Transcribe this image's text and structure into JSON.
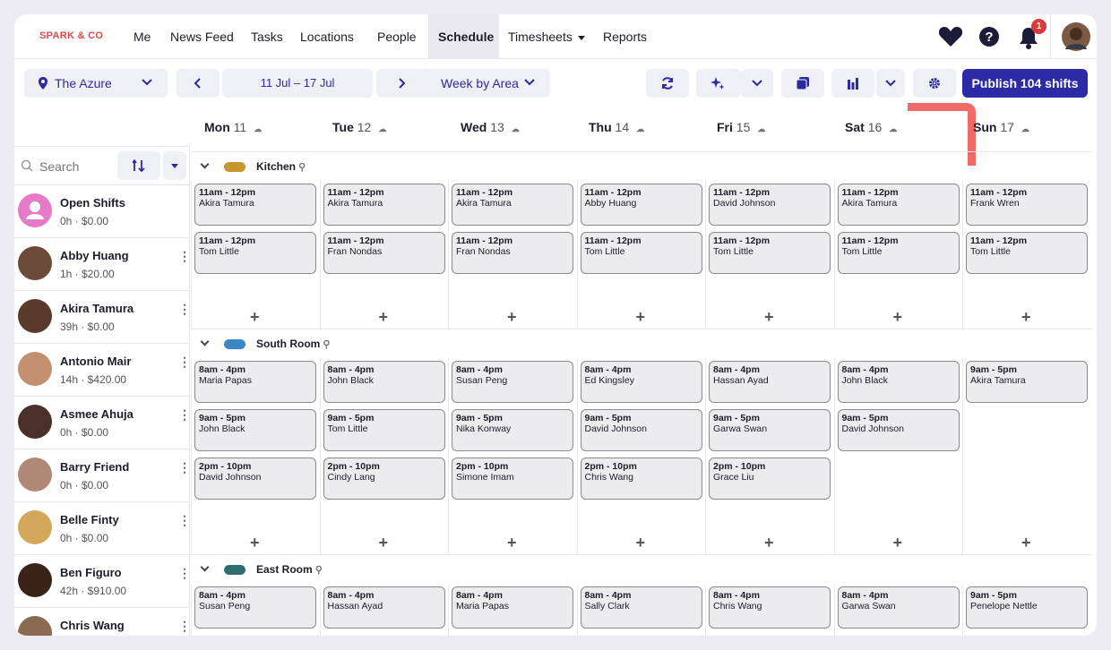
{
  "brand": "SPARK & CO",
  "nav": {
    "items": [
      "Me",
      "News Feed",
      "Tasks",
      "Locations",
      "People",
      "Schedule",
      "Timesheets",
      "Reports"
    ],
    "active": "Schedule",
    "notification_count": "1"
  },
  "toolbar": {
    "location": "The Azure",
    "date_range": "11 Jul – 17 Jul",
    "view": "Week by Area",
    "publish_label": "Publish 104 shifts"
  },
  "days": [
    {
      "name": "Mon",
      "num": "11"
    },
    {
      "name": "Tue",
      "num": "12"
    },
    {
      "name": "Wed",
      "num": "13"
    },
    {
      "name": "Thu",
      "num": "14"
    },
    {
      "name": "Fri",
      "num": "15"
    },
    {
      "name": "Sat",
      "num": "16"
    },
    {
      "name": "Sun",
      "num": "17"
    }
  ],
  "sidebar": {
    "search_placeholder": "Search",
    "people": [
      {
        "name": "Open Shifts",
        "meta": "0h · $0.00"
      },
      {
        "name": "Abby Huang",
        "meta": "1h · $20.00"
      },
      {
        "name": "Akira Tamura",
        "meta": "39h · $0.00"
      },
      {
        "name": "Antonio Mair",
        "meta": "14h · $420.00"
      },
      {
        "name": "Asmee Ahuja",
        "meta": "0h · $0.00"
      },
      {
        "name": "Barry Friend",
        "meta": "0h · $0.00"
      },
      {
        "name": "Belle Finty",
        "meta": "0h · $0.00"
      },
      {
        "name": "Ben Figuro",
        "meta": "42h · $910.00"
      },
      {
        "name": "Chris Wang",
        "meta": ""
      }
    ]
  },
  "areas": [
    {
      "name": "Kitchen",
      "color": "#c8962e",
      "shifts": [
        [
          {
            "time": "11am - 12pm",
            "who": "Akira Tamura"
          },
          {
            "time": "11am - 12pm",
            "who": "Tom Little"
          }
        ],
        [
          {
            "time": "11am - 12pm",
            "who": "Akira Tamura"
          },
          {
            "time": "11am - 12pm",
            "who": "Fran Nondas"
          }
        ],
        [
          {
            "time": "11am - 12pm",
            "who": "Akira Tamura"
          },
          {
            "time": "11am - 12pm",
            "who": "Fran Nondas"
          }
        ],
        [
          {
            "time": "11am - 12pm",
            "who": "Abby Huang"
          },
          {
            "time": "11am - 12pm",
            "who": "Tom Little"
          }
        ],
        [
          {
            "time": "11am - 12pm",
            "who": "David Johnson"
          },
          {
            "time": "11am - 12pm",
            "who": "Tom Little"
          }
        ],
        [
          {
            "time": "11am - 12pm",
            "who": "Akira Tamura"
          },
          {
            "time": "11am - 12pm",
            "who": "Tom Little"
          }
        ],
        [
          {
            "time": "11am - 12pm",
            "who": "Frank Wren"
          },
          {
            "time": "11am - 12pm",
            "who": "Tom Little"
          }
        ]
      ]
    },
    {
      "name": "South Room",
      "color": "#3d86c6",
      "shifts": [
        [
          {
            "time": "8am - 4pm",
            "who": "Maria Papas"
          },
          {
            "time": "9am - 5pm",
            "who": "John Black"
          },
          {
            "time": "2pm - 10pm",
            "who": "David Johnson"
          }
        ],
        [
          {
            "time": "8am - 4pm",
            "who": "John Black"
          },
          {
            "time": "9am - 5pm",
            "who": "Tom Little"
          },
          {
            "time": "2pm - 10pm",
            "who": "Cindy Lang"
          }
        ],
        [
          {
            "time": "8am - 4pm",
            "who": "Susan Peng"
          },
          {
            "time": "9am - 5pm",
            "who": "Nika Konway"
          },
          {
            "time": "2pm - 10pm",
            "who": "Simone Imam"
          }
        ],
        [
          {
            "time": "8am - 4pm",
            "who": "Ed Kingsley"
          },
          {
            "time": "9am - 5pm",
            "who": "David Johnson"
          },
          {
            "time": "2pm - 10pm",
            "who": "Chris Wang"
          }
        ],
        [
          {
            "time": "8am - 4pm",
            "who": "Hassan Ayad"
          },
          {
            "time": "9am - 5pm",
            "who": "Garwa Swan"
          },
          {
            "time": "2pm - 10pm",
            "who": "Grace Liu"
          }
        ],
        [
          {
            "time": "8am - 4pm",
            "who": "John Black"
          },
          {
            "time": "9am - 5pm",
            "who": "David Johnson"
          }
        ],
        [
          {
            "time": "9am - 5pm",
            "who": "Akira Tamura"
          }
        ]
      ]
    },
    {
      "name": "East Room",
      "color": "#2e6d72",
      "shifts": [
        [
          {
            "time": "8am - 4pm",
            "who": "Susan Peng"
          }
        ],
        [
          {
            "time": "8am - 4pm",
            "who": "Hassan Ayad"
          }
        ],
        [
          {
            "time": "8am - 4pm",
            "who": "Maria Papas"
          }
        ],
        [
          {
            "time": "8am - 4pm",
            "who": "Sally Clark"
          }
        ],
        [
          {
            "time": "8am - 4pm",
            "who": "Chris Wang"
          }
        ],
        [
          {
            "time": "8am - 4pm",
            "who": "Garwa Swan"
          }
        ],
        [
          {
            "time": "9am - 5pm",
            "who": "Penelope Nettle"
          }
        ]
      ]
    }
  ],
  "colors": {
    "accent": "#2d2aa6",
    "brand": "#e0484a",
    "annotation": "#f06a68"
  }
}
